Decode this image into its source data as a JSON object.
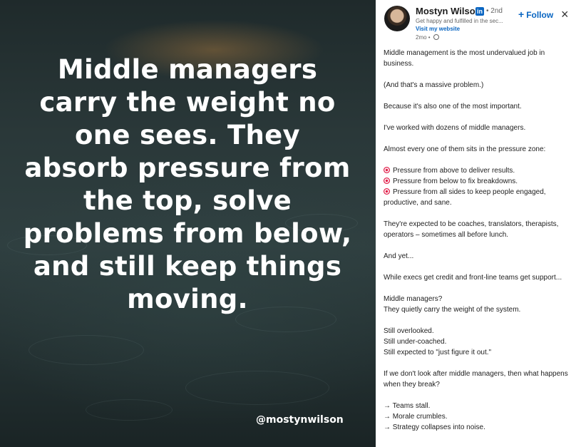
{
  "image": {
    "quote": "Middle managers carry the weight no one sees. They absorb pressure from the top, solve problems from below, and still keep things moving.",
    "handle": "@mostynwilson"
  },
  "author": {
    "name": "Mostyn Wilson",
    "network_badge": "in",
    "degree": "• 2nd",
    "tagline": "Get happy and fulfilled in the sec...",
    "website": "Visit my website",
    "time": "2mo •"
  },
  "actions": {
    "follow": "Follow",
    "follow_icon": "+",
    "close_icon": "×"
  },
  "post": {
    "p1": "Middle management is the most undervalued job in business.",
    "p2": "(And that's a massive problem.)",
    "p3": "Because it's also one of the most important.",
    "p4": "I've worked with dozens of middle managers.",
    "p5": "Almost every one of them sits in the pressure zone:",
    "bullets": [
      "Pressure from above to deliver results.",
      "Pressure from below to fix breakdowns.",
      "Pressure from all sides to keep people engaged, productive, and sane."
    ],
    "p6": "They're expected to be coaches, translators, therapists, operators – sometimes all before lunch.",
    "p7": "And yet...",
    "p8": "While execs get credit and front-line teams get support...",
    "p9a": "Middle managers?",
    "p9b": "They quietly carry the weight of the system.",
    "p10a": "Still overlooked.",
    "p10b": "Still under-coached.",
    "p10c": "Still expected to \"just figure it out.\"",
    "p11": "If we don't look after middle managers, then what happens when they break?",
    "arrows": [
      "→ Teams stall.",
      "→ Morale crumbles.",
      "→ Strategy collapses into noise."
    ]
  }
}
